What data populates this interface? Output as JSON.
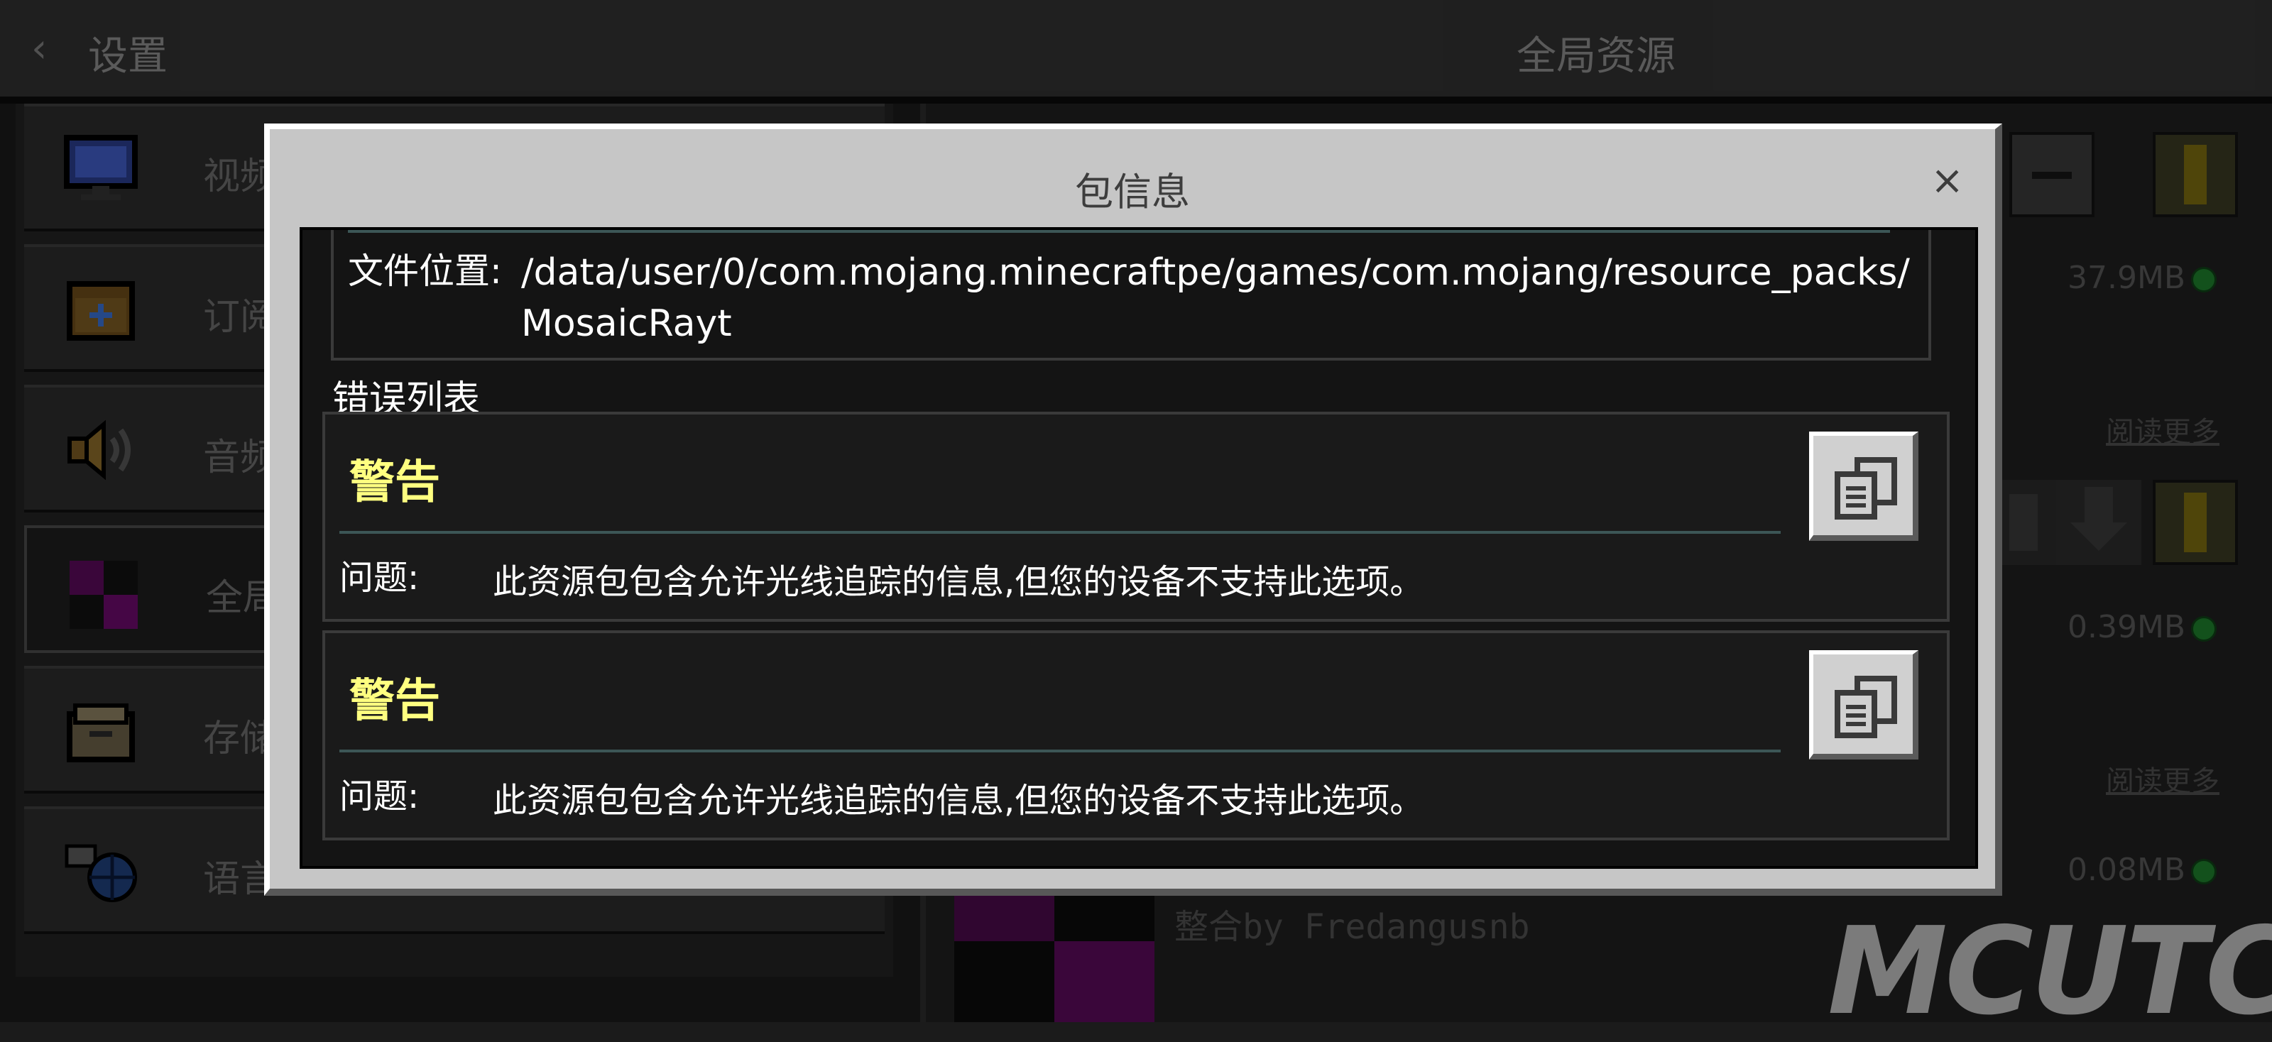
{
  "topbar": {
    "back_label": "设置",
    "center_title": "全局资源"
  },
  "sidebar": {
    "items": [
      {
        "label": "视频",
        "icon": "monitor-icon"
      },
      {
        "label": "订阅",
        "icon": "calendar-icon"
      },
      {
        "label": "音频",
        "icon": "speaker-icon"
      },
      {
        "label": "全局资源",
        "icon": "resource-pack-icon"
      },
      {
        "label": "存储",
        "icon": "folder-icon"
      },
      {
        "label": "语言",
        "icon": "language-globe-icon"
      }
    ]
  },
  "right": {
    "sizes": [
      "37.9MB",
      "0.39MB",
      "0.08MB"
    ],
    "read_more": "阅读更多",
    "by_text": "整合by Fredangusnb",
    "logo": "MCUTC"
  },
  "modal": {
    "title": "包信息",
    "close": "×",
    "path_label": "文件位置:",
    "path_value": "/data/user/0/com.mojang.minecraftpe/games/com.mojang/resource_packs/MosaicRayt",
    "error_list_title": "错误列表",
    "errors": [
      {
        "title": "警告",
        "label": "问题:",
        "text": "此资源包包含允许光线追踪的信息,但您的设备不支持此选项。"
      },
      {
        "title": "警告",
        "label": "问题:",
        "text": "此资源包包含允许光线追踪的信息,但您的设备不支持此选项。"
      }
    ]
  },
  "colors": {
    "warning": "#ffff80",
    "modal_bg": "#c6c6c6",
    "panel_bg": "#141414",
    "status_green": "#1e7d2c"
  }
}
